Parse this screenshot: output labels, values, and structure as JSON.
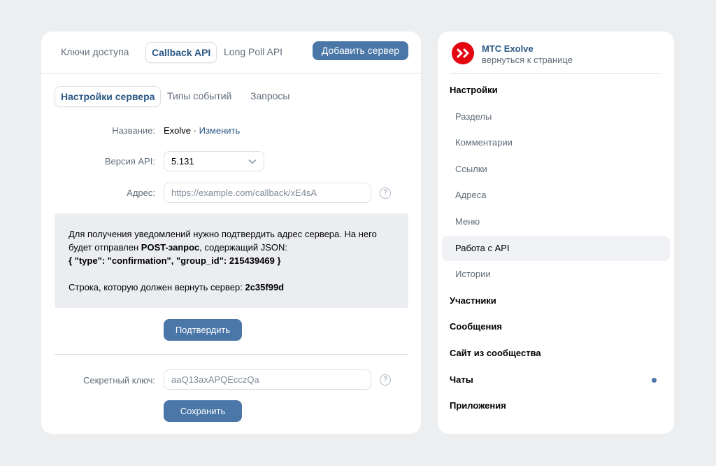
{
  "tabs": {
    "keys": "Ключи доступа",
    "callback": "Callback API",
    "longpoll": "Long Poll API",
    "add_server": "Добавить сервер"
  },
  "subtabs": {
    "settings": "Настройки сервера",
    "events": "Типы событий",
    "requests": "Запросы"
  },
  "form": {
    "name_label": "Название:",
    "name_value": "Exolve",
    "name_sep": " · ",
    "name_edit": "Изменить",
    "version_label": "Версия API:",
    "version_value": "5.131",
    "address_label": "Адрес:",
    "address_placeholder": "https://example.com/callback/xE4sA",
    "help_glyph": "?",
    "secret_label": "Секретный ключ:",
    "secret_placeholder": "aaQ13axAPQEcczQa",
    "confirm_button": "Подтвердить",
    "save_button": "Сохранить"
  },
  "info": {
    "line1": "Для получения уведомлений нужно подтвердить адрес сервера. На него",
    "line2_pre": "будет отправлен ",
    "line2_bold": "POST-запрос",
    "line2_post": ", содержащий JSON:",
    "line3": "{ \"type\": \"confirmation\", \"group_id\": 215439469 }",
    "line4_pre": "Строка, которую должен вернуть сервер: ",
    "line4_bold": "2c35f99d"
  },
  "sidebar": {
    "title": "МТС Exolve",
    "subtitle": "вернуться к странице",
    "items": [
      {
        "label": "Настройки",
        "level": "top"
      },
      {
        "label": "Разделы",
        "level": "sub"
      },
      {
        "label": "Комментарии",
        "level": "sub"
      },
      {
        "label": "Ссылки",
        "level": "sub"
      },
      {
        "label": "Адреса",
        "level": "sub"
      },
      {
        "label": "Меню",
        "level": "sub"
      },
      {
        "label": "Работа с API",
        "level": "sub",
        "selected": true
      },
      {
        "label": "Истории",
        "level": "sub"
      },
      {
        "label": "Участники",
        "level": "top"
      },
      {
        "label": "Сообщения",
        "level": "top"
      },
      {
        "label": "Сайт из сообщества",
        "level": "top"
      },
      {
        "label": "Чаты",
        "level": "top",
        "badge_dot": true
      },
      {
        "label": "Приложения",
        "level": "top"
      }
    ]
  },
  "colors": {
    "accent": "#4a76a8",
    "link": "#2a5885",
    "brand_red": "#e30611"
  }
}
